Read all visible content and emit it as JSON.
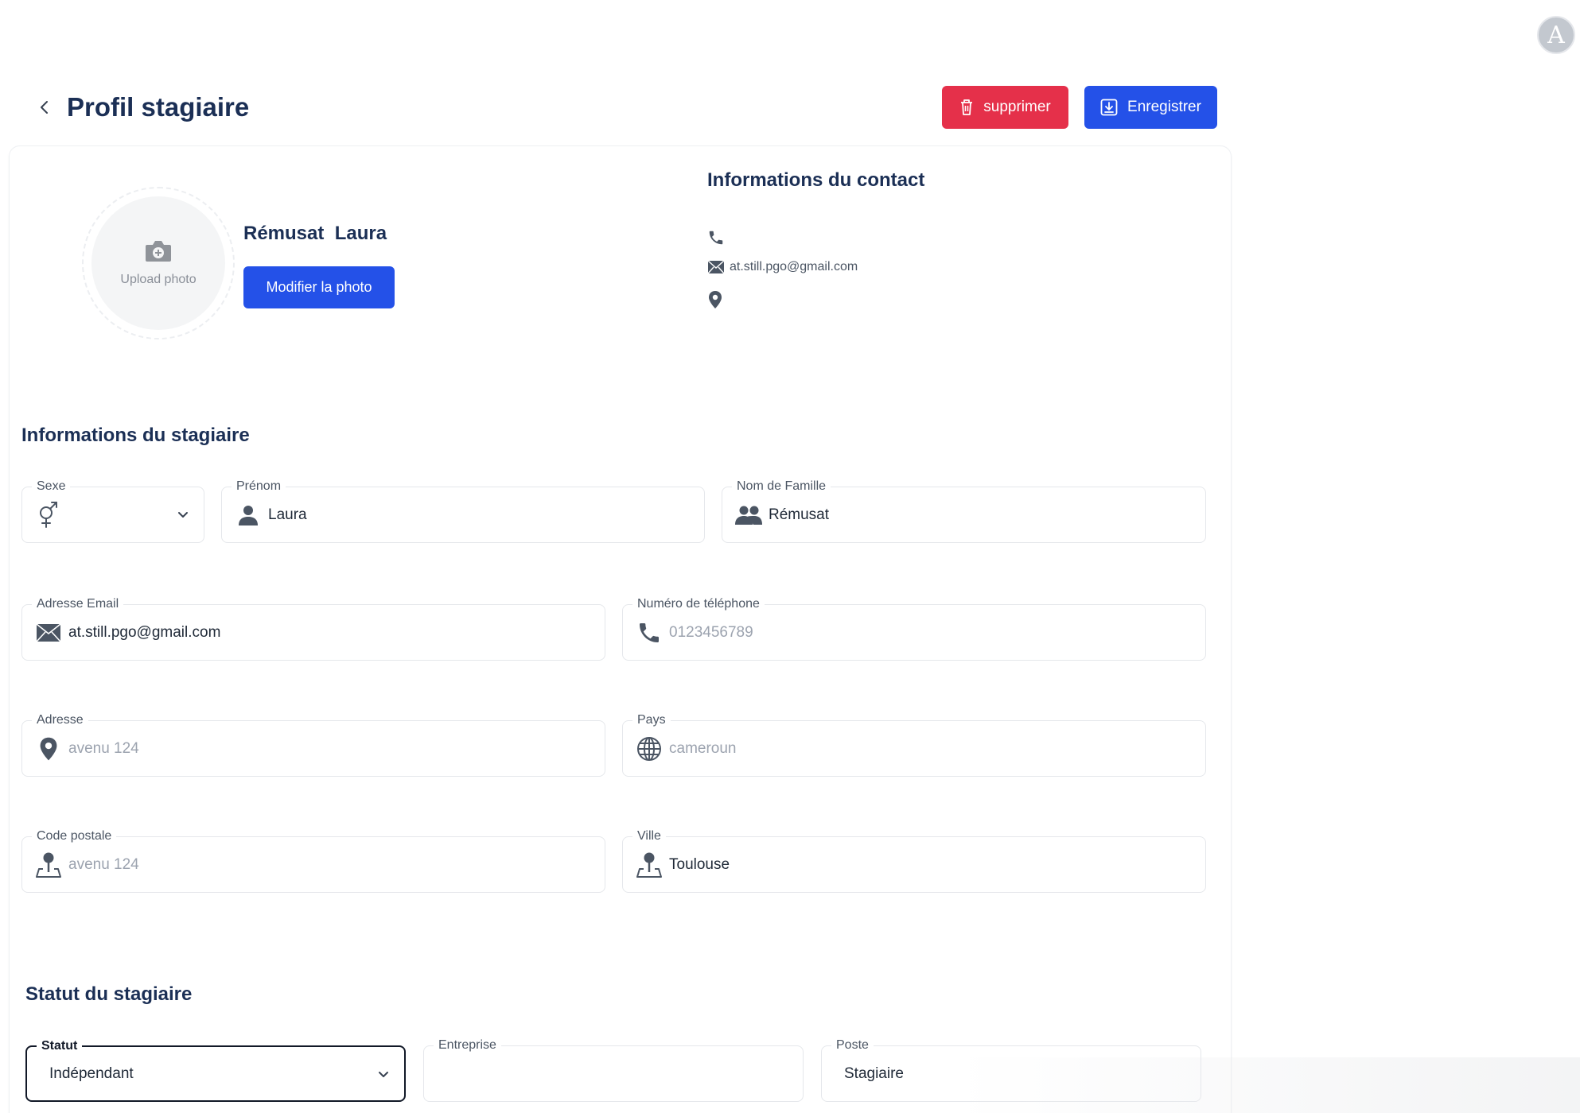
{
  "user": {
    "avatar_letter": "A"
  },
  "header": {
    "title": "Profil stagiaire",
    "delete_label": "supprimer",
    "save_label": "Enregistrer"
  },
  "profile": {
    "upload_text": "Upload photo",
    "name": "Rémusat  Laura",
    "change_photo_label": "Modifier la photo"
  },
  "contact": {
    "title": "Informations du contact",
    "phone": "",
    "email": "at.still.pgo@gmail.com",
    "address": ""
  },
  "intern_info": {
    "title": "Informations du stagiaire",
    "sexe": {
      "label": "Sexe",
      "value": ""
    },
    "prenom": {
      "label": "Prénom",
      "value": "Laura"
    },
    "nom": {
      "label": "Nom de Famille",
      "value": "Rémusat"
    },
    "email": {
      "label": "Adresse Email",
      "value": "at.still.pgo@gmail.com"
    },
    "phone": {
      "label": "Numéro de téléphone",
      "placeholder": "0123456789"
    },
    "adresse": {
      "label": "Adresse",
      "placeholder": "avenu 124"
    },
    "pays": {
      "label": "Pays",
      "placeholder": "cameroun"
    },
    "code_postal": {
      "label": "Code postale",
      "placeholder": "avenu 124"
    },
    "ville": {
      "label": "Ville",
      "value": "Toulouse"
    }
  },
  "status": {
    "title": "Statut du stagiaire",
    "statut": {
      "label": "Statut",
      "value": "Indépendant"
    },
    "entreprise": {
      "label": "Entreprise",
      "value": ""
    },
    "poste": {
      "label": "Poste",
      "value": "Stagiaire"
    }
  },
  "colors": {
    "primary": "#2451e8",
    "danger": "#e5304a",
    "heading": "#1b2f55"
  }
}
